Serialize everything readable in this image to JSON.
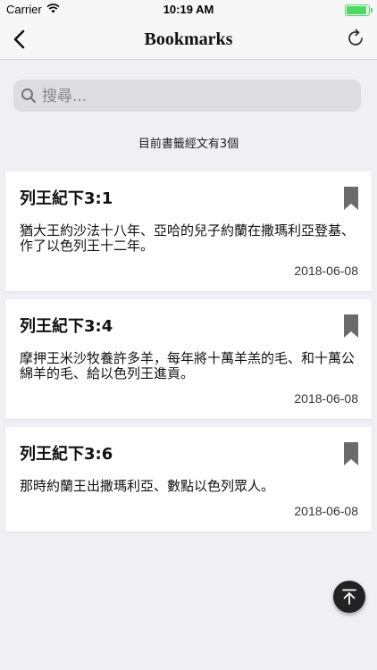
{
  "status_bar": {
    "carrier": "Carrier",
    "time": "10:19 AM"
  },
  "nav": {
    "title": "Bookmarks",
    "back_icon": "chevron-left-icon",
    "refresh_icon": "refresh-icon"
  },
  "search": {
    "placeholder": "搜尋..."
  },
  "summary": "目前書籤經文有3個",
  "bookmarks": [
    {
      "reference": "列王紀下3:1",
      "verse": "猶大王約沙法十八年、亞哈的兒子約蘭在撒瑪利亞登基、作了以色列王十二年。",
      "date": "2018-06-08"
    },
    {
      "reference": "列王紀下3:4",
      "verse": "摩押王米沙牧養許多羊，每年將十萬羊羔的毛、和十萬公綿羊的毛、給以色列王進貢。",
      "date": "2018-06-08"
    },
    {
      "reference": "列王紀下3:6",
      "verse": "那時約蘭王出撒瑪利亞、數點以色列眾人。",
      "date": "2018-06-08"
    }
  ],
  "colors": {
    "background": "#efeff4",
    "card": "#ffffff",
    "bookmark_icon": "#6b6b6b",
    "battery": "#4cd964",
    "fab": "#222222"
  }
}
